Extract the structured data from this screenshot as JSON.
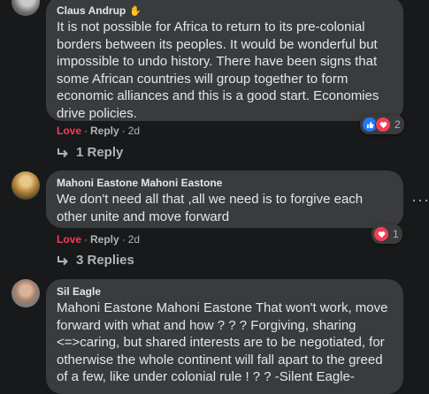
{
  "comments": [
    {
      "author": "Claus Andrup",
      "text": "It is not possible for Africa to return to its pre-colonial borders between its peoples. It would be wonderful but impossible to undo history. There have been signs that some African countries will group together to form economic alliances and this is a good start. Economies drive policies.",
      "love_label": "Love",
      "reply_label": "Reply",
      "time": "2d",
      "reaction_count": "2",
      "replies_label": "1 Reply"
    },
    {
      "author": "Mahoni Eastone Mahoni Eastone",
      "text": "We don't need all that ,all we need is to forgive each other unite and move forward",
      "love_label": "Love",
      "reply_label": "Reply",
      "time": "2d",
      "reaction_count": "1",
      "replies_label": "3 Replies"
    },
    {
      "author": "Sil Eagle",
      "text": "Mahoni Eastone Mahoni Eastone That won't work, move forward with what and how ? ? ? Forgiving, sharing <=>caring, but shared interests are to be negotiated, for otherwise the whole continent will fall apart to the greed of a few, like under colonial rule ! ? ? -Silent Eagle-"
    }
  ],
  "colors": {
    "love": "#f33e58",
    "like": "#2078f4",
    "bubble": "#3a3b3c",
    "background": "#18191a"
  }
}
